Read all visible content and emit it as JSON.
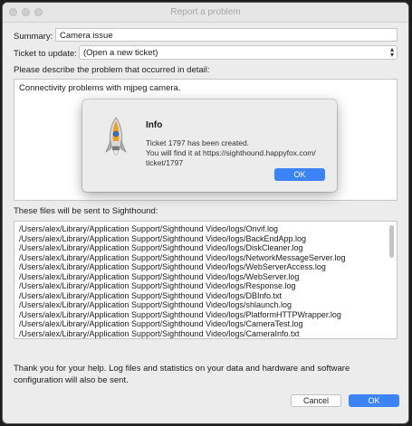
{
  "window": {
    "title": "Report a problem"
  },
  "form": {
    "summary_label": "Summary:",
    "summary_value": "Camera issue",
    "ticket_label": "Ticket to update:",
    "ticket_value": "(Open a new ticket)",
    "describe_label": "Please describe the problem that occurred in detail:",
    "description": "Connectivity problems with mjpeg camera.",
    "files_label": "These files will be sent to Sighthound:",
    "files": [
      "/Users/alex/Library/Application Support/Sighthound Video/logs/Onvif.log",
      "/Users/alex/Library/Application Support/Sighthound Video/logs/BackEndApp.log",
      "/Users/alex/Library/Application Support/Sighthound Video/logs/DiskCleaner.log",
      "/Users/alex/Library/Application Support/Sighthound Video/logs/NetworkMessageServer.log",
      "/Users/alex/Library/Application Support/Sighthound Video/logs/WebServerAccess.log",
      "/Users/alex/Library/Application Support/Sighthound Video/logs/WebServer.log",
      "/Users/alex/Library/Application Support/Sighthound Video/logs/Response.log",
      "/Users/alex/Library/Application Support/Sighthound Video/logs/DBInfo.txt",
      "/Users/alex/Library/Application Support/Sighthound Video/logs/shlaunch.log",
      "/Users/alex/Library/Application Support/Sighthound Video/logs/PlatformHTTPWrapper.log",
      "/Users/alex/Library/Application Support/Sighthound Video/logs/CameraTest.log",
      "/Users/alex/Library/Application Support/Sighthound Video/logs/CameraInfo.txt"
    ],
    "thanks": "Thank you for your help.  Log files and statistics on your data and hardware and software configuration will also be sent."
  },
  "buttons": {
    "cancel": "Cancel",
    "ok": "OK"
  },
  "dialog": {
    "icon": "rocket-icon",
    "title": "Info",
    "message_line1": "Ticket 1797 has been created.",
    "message_line2": "You will find it at https://sighthound.happyfox.com/",
    "message_line3": "ticket/1797",
    "ok": "OK"
  },
  "colors": {
    "accent": "#3b83f7"
  }
}
